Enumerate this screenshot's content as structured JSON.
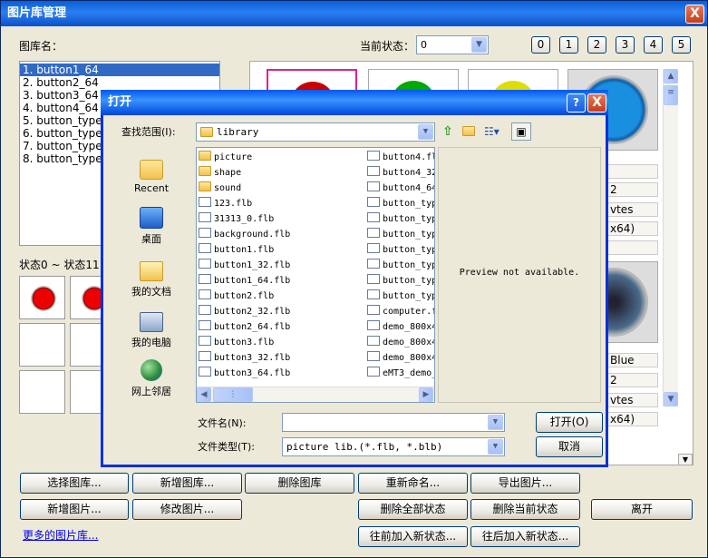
{
  "main": {
    "title": "图片库管理",
    "close": "X",
    "libname_label": "图库名：",
    "state_label": "当前状态：",
    "state_value": "0",
    "state_buttons": [
      "0",
      "1",
      "2",
      "3",
      "4",
      "5"
    ],
    "library_list": [
      "1. button1_64",
      "2. button2_64",
      "3. button3_64",
      "4. button4_64",
      "5. button_type",
      "6. button_type",
      "7. button_type",
      "8. button_type"
    ],
    "state_range": "状态0 ~ 状态11",
    "props": [
      "2",
      "vtes",
      "x64)",
      "Blue",
      "2",
      "vtes",
      "x64)"
    ],
    "buttons": {
      "select_lib": "选择图库...",
      "new_lib": "新增图库...",
      "delete_lib": "删除图库",
      "rename": "重新命名...",
      "export": "导出图片...",
      "new_pic": "新增图片...",
      "edit_pic": "修改图片...",
      "delete_all_states": "删除全部状态",
      "delete_current_state": "删除当前状态",
      "leave": "离开",
      "add_before": "往前加入新状态...",
      "add_after": "往后加入新状态..."
    },
    "more_link": "更多的图片库..."
  },
  "dialog": {
    "title": "打开",
    "help": "?",
    "close": "X",
    "lookin_label": "查找范围(I):",
    "lookin_value": "library",
    "places": [
      "Recent",
      "桌面",
      "我的文档",
      "我的电脑",
      "网上邻居"
    ],
    "files_col1": [
      {
        "name": "picture",
        "type": "folder"
      },
      {
        "name": "shape",
        "type": "folder"
      },
      {
        "name": "sound",
        "type": "folder"
      },
      {
        "name": "123.flb",
        "type": "file"
      },
      {
        "name": "31313_0.flb",
        "type": "file"
      },
      {
        "name": "background.flb",
        "type": "file"
      },
      {
        "name": "button1.flb",
        "type": "file"
      },
      {
        "name": "button1_32.flb",
        "type": "file"
      },
      {
        "name": "button1_64.flb",
        "type": "file"
      },
      {
        "name": "button2.flb",
        "type": "file"
      },
      {
        "name": "button2_32.flb",
        "type": "file"
      },
      {
        "name": "button2_64.flb",
        "type": "file"
      },
      {
        "name": "button3.flb",
        "type": "file"
      },
      {
        "name": "button3_32.flb",
        "type": "file"
      },
      {
        "name": "button3_64.flb",
        "type": "file"
      }
    ],
    "files_col2": [
      "button4.fl",
      "button4_32",
      "button4_64",
      "button_typ",
      "button_typ",
      "button_typ",
      "button_typ",
      "button_typ",
      "button_typ",
      "button_typ",
      "computer.f",
      "demo_800x4",
      "demo_800x4",
      "demo_800x4",
      "eMT3_demo_"
    ],
    "preview_text": "Preview not available.",
    "filename_label": "文件名(N):",
    "filename_value": "",
    "filetype_label": "文件类型(T):",
    "filetype_value": "picture lib.(*.flb, *.blb)",
    "open_button": "打开(O)",
    "cancel_button": "取消"
  },
  "colors": {
    "title_blue": "#0a5fd8",
    "selected": "#316ac5",
    "face": "#ece9d8"
  }
}
